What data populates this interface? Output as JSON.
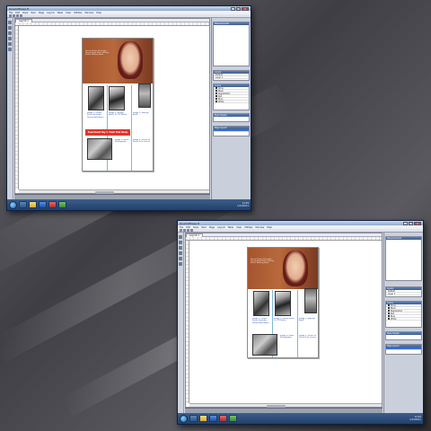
{
  "background": {
    "colors": [
      "#6a6a70",
      "#3e3e44",
      "#2f2f34"
    ]
  },
  "screenshots": [
    {
      "window_title": "QuarkXPress 8",
      "menu": [
        "File",
        "Edit",
        "Style",
        "Item",
        "Page",
        "Layout",
        "Table",
        "View",
        "Utilities",
        "Window",
        "Help"
      ],
      "doc_tab": "Layout 1",
      "zoom": "75%",
      "page": {
        "caption_lines": [
          "Image 1: Dream Potter Reminder - Dream Bath Boxes",
          "Image 2: Whisky Bottle To OTZ Bottle",
          "Image 3: Walking Book"
        ],
        "red_banner": "Experiment Day 2. Trash Trail Dump",
        "bottom_captions": [
          "Image 4: Room Photography",
          "Image 5: Yellow Go Sheet & Go Leaves"
        ]
      },
      "panels": [
        "Measurements",
        "Layers",
        "Colors",
        "Style Sheets",
        "Page Layout"
      ],
      "layers": [
        "Default",
        "Layer 1"
      ],
      "colors": [
        {
          "name": "None",
          "color": "#ffffff"
        },
        {
          "name": "Black",
          "color": "#000000"
        },
        {
          "name": "Registration",
          "color": "#222222"
        },
        {
          "name": "Red",
          "color": "#e0352b"
        },
        {
          "name": "Blue",
          "color": "#1e4aa0"
        },
        {
          "name": "White",
          "color": "#ffffff"
        }
      ],
      "clock": {
        "time": "12:49",
        "date": "1/13/2011"
      }
    },
    {
      "window_title": "QuarkXPress 8",
      "menu": [
        "File",
        "Edit",
        "Style",
        "Item",
        "Page",
        "Layout",
        "Table",
        "View",
        "Utilities",
        "Window",
        "Help"
      ],
      "doc_tab": "Layout 1",
      "zoom": "75%",
      "page": {
        "caption_lines": [
          "Image 1: Dream Potter Reminder - Dream Bath Boxes",
          "Image 2: Whisky Bottle To OTZ Bottle",
          "Image 3: Walking Book"
        ],
        "red_banner": "",
        "bottom_captions": [
          "Image 4: Room Photography",
          "Image 5: Yellow Go Sheet & Go Leaves"
        ]
      },
      "panels": [
        "Measurements",
        "Layers",
        "Colors",
        "Style Sheets",
        "Page Layout"
      ],
      "layers": [
        "Default",
        "Layer 1"
      ],
      "colors": [
        {
          "name": "None",
          "color": "#ffffff"
        },
        {
          "name": "Black",
          "color": "#000000"
        },
        {
          "name": "Registration",
          "color": "#222222"
        },
        {
          "name": "Red",
          "color": "#e0352b"
        },
        {
          "name": "Blue",
          "color": "#1e4aa0"
        },
        {
          "name": "White",
          "color": "#ffffff"
        }
      ],
      "clock": {
        "time": "12:49",
        "date": "1/13/2011"
      }
    }
  ]
}
